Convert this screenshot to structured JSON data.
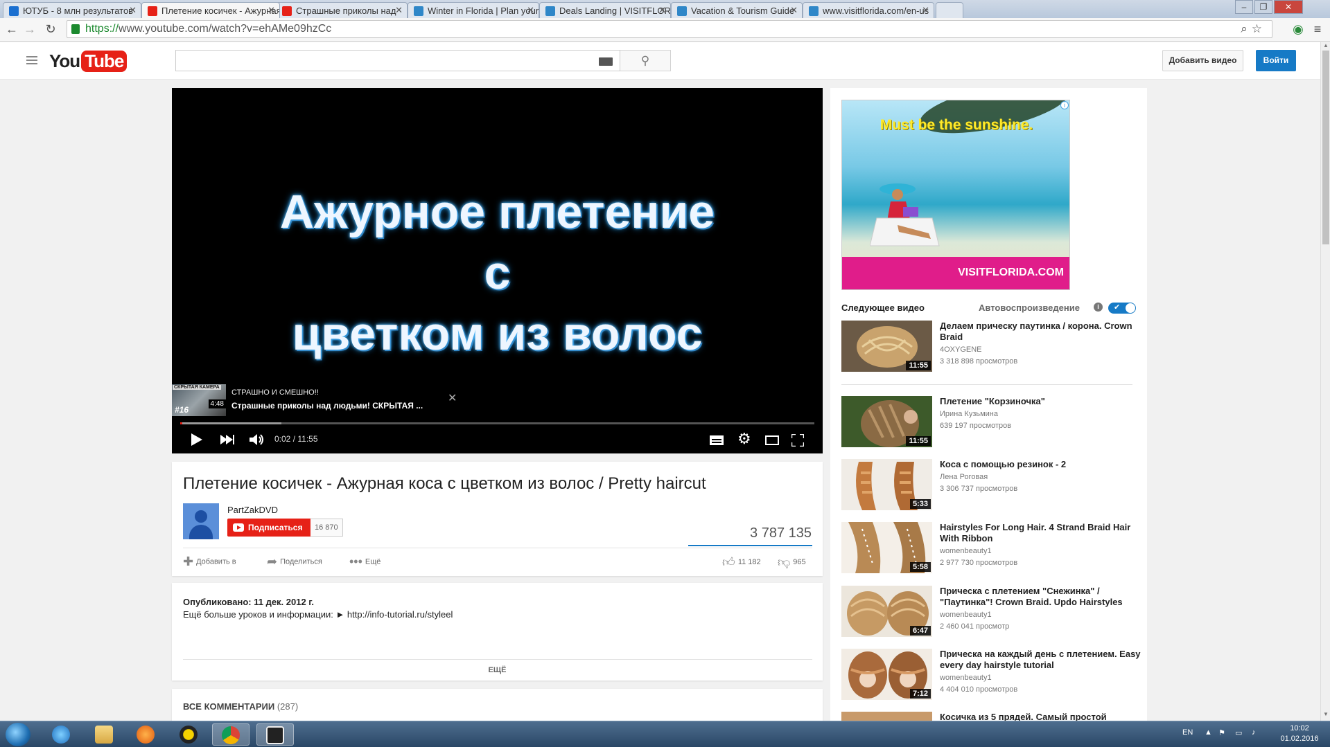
{
  "browser": {
    "tabs": [
      {
        "title": "ЮТУБ - 8 млн результатов",
        "favicon_color": "#1a6fd0"
      },
      {
        "title": "Плетение косичек - Ажурная",
        "favicon_color": "#e62117"
      },
      {
        "title": "Страшные приколы над",
        "favicon_color": "#e62117"
      },
      {
        "title": "Winter in Florida | Plan your",
        "favicon_color": "#2f87c8"
      },
      {
        "title": "Deals Landing | VISITFLORIDA",
        "favicon_color": "#2f87c8"
      },
      {
        "title": "Vacation & Tourism Guide",
        "favicon_color": "#2f87c8"
      },
      {
        "title": "www.visitflorida.com/en-us",
        "favicon_color": "#2f87c8"
      }
    ],
    "url_scheme": "https://",
    "url_rest": "www.youtube.com/watch?v=ehAMe09hzCc"
  },
  "masthead": {
    "logo_you": "You",
    "logo_tube": "Tube",
    "search_placeholder": "",
    "upload_label": "Добавить видео",
    "signin_label": "Войти"
  },
  "player": {
    "overlay_title_lines": [
      "Ажурное плетение",
      "с",
      "цветком из волос"
    ],
    "annotation": {
      "thumb_tag": "СКРЫТАЯ КАМЕРА",
      "thumb_number": "#16",
      "duration": "4:48",
      "channel": "СТРАШНО И СМЕШНО!!",
      "title": "Страшные приколы над людьми! СКРЫТАЯ ..."
    },
    "time_current": "0:02",
    "time_total": "11:55",
    "time_display": "0:02 / 11:55",
    "progress_played_fraction": 0.003,
    "progress_loaded_fraction": 0.16
  },
  "video": {
    "title": "Плетение косичек - Ажурная коса с цветком из волос / Pretty haircut",
    "channel": "PartZakDVD",
    "subscribe_label": "Подписаться",
    "subscriber_count": "16 870",
    "views": "3 787 135",
    "actions": {
      "add_to": "Добавить в",
      "share": "Поделиться",
      "more": "Ещё"
    },
    "likes": "11 182",
    "dislikes": "965",
    "published": "Опубликовано: 11 дек. 2012 г.",
    "description": "Ещё больше уроков и информации: ► http://info-tutorial.ru/styleel",
    "show_more": "ЕЩЁ",
    "comments_label": "ВСЕ КОММЕНТАРИИ",
    "comments_count": "(287)"
  },
  "ad": {
    "headline": "Must be the sunshine.",
    "brand": "VISITFLORIDA.COM",
    "banner_color": "#e01d8a",
    "headline_color": "#ffea2a"
  },
  "sidebar": {
    "next_label": "Следующее видео",
    "autoplay_label": "Автовоспроизведение",
    "autoplay_on": true,
    "videos": [
      {
        "title": "Делаем прическу паутинка / корона. Crown Braid",
        "channel": "4OXYGENE",
        "views": "3 318 898 просмотров",
        "duration": "11:55"
      },
      {
        "title": "Плетение \"Корзиночка\"",
        "channel": "Ирина Кузьмина",
        "views": "639 197 просмотров",
        "duration": "11:55"
      },
      {
        "title": "Коса с помощью резинок - 2",
        "channel": "Лена Роговая",
        "views": "3 306 737 просмотров",
        "duration": "5:33"
      },
      {
        "title": "Hairstyles For Long Hair. 4 Strand Braid Hair With Ribbon",
        "channel": "womenbeauty1",
        "views": "2 977 730 просмотров",
        "duration": "5:58"
      },
      {
        "title": "Прическа с плетением \"Снежинка\" / \"Паутинка\"! Crown Braid. Updo Hairstyles",
        "channel": "womenbeauty1",
        "views": "2 460 041 просмотр",
        "duration": "6:47"
      },
      {
        "title": "Прическа на каждый день с плетением. Easy every day hairstyle tutorial",
        "channel": "womenbeauty1",
        "views": "4 404 010 просмотров",
        "duration": "7:12"
      },
      {
        "title": "Косичка из 5 прядей. Самый простой",
        "channel": "",
        "views": "",
        "duration": ""
      }
    ]
  },
  "taskbar": {
    "lang": "EN",
    "time": "10:02",
    "date": "01.02.2016"
  }
}
